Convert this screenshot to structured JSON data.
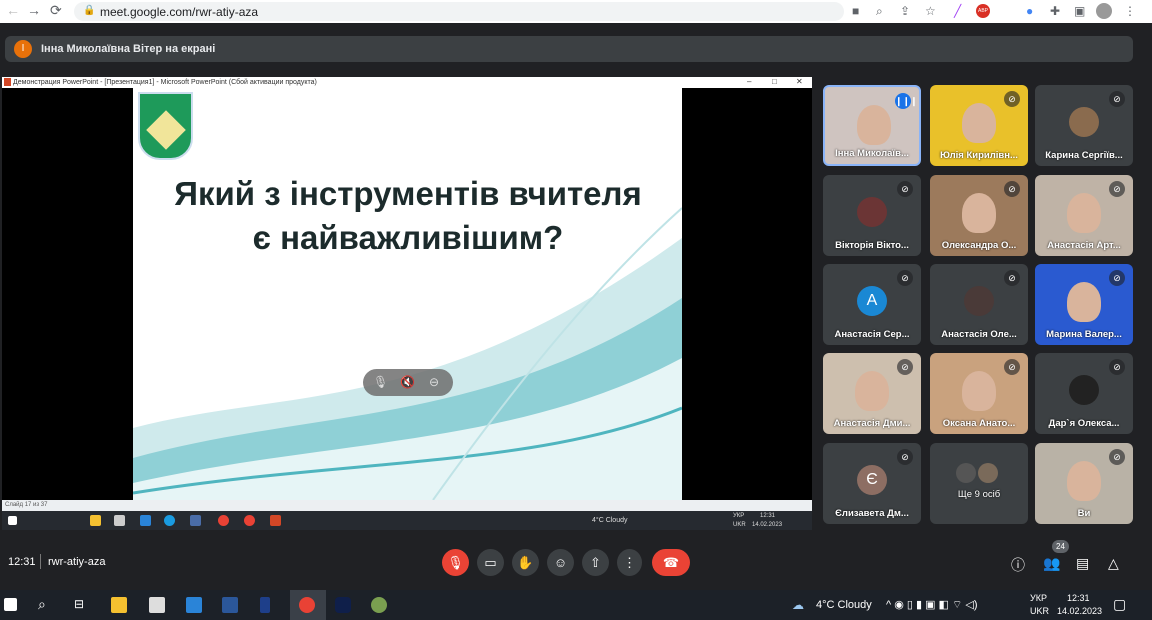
{
  "browser": {
    "url": "meet.google.com/rwr-atiy-aza",
    "back": "←",
    "forward": "→",
    "reload": "⟳",
    "profile_badge": "ABP"
  },
  "banner": {
    "initial": "І",
    "text": "Інна Миколаївна Вітер на екрані"
  },
  "presentation": {
    "window_title": "Демонстрация PowerPoint - [Презентация1] - Microsoft PowerPoint (Сбой активации продукта)",
    "slide_title": "Який з інструментів вчителя є найважливішим?",
    "status": "Слайд 17 из 37",
    "taskbar": {
      "weather": "4°C Cloudy",
      "lang1": "УКР",
      "lang2": "UKR",
      "time": "12:31",
      "date": "14.02.2023"
    }
  },
  "tiles": [
    {
      "name": "Інна Миколаїв...",
      "type": "video",
      "bg": "#cfc4c0",
      "speaking": true
    },
    {
      "name": "Юлія Кирилівн...",
      "type": "video",
      "bg": "#e9c12a"
    },
    {
      "name": "Карина Сергіїв...",
      "type": "photo",
      "bg": "#8a6b4e"
    },
    {
      "name": "Вікторія Вікто...",
      "type": "photo",
      "bg": "#6b3535"
    },
    {
      "name": "Олександра О...",
      "type": "video",
      "bg": "#9c7a5c"
    },
    {
      "name": "Анастасія Арт...",
      "type": "video",
      "bg": "#bfb3a6"
    },
    {
      "name": "Анастасія Сер...",
      "type": "letter",
      "letter": "А",
      "bg": "#1a88d4"
    },
    {
      "name": "Анастасія Оле...",
      "type": "photo",
      "bg": "#4a3a38"
    },
    {
      "name": "Марина Валер...",
      "type": "video",
      "bg": "#2a5ad0"
    },
    {
      "name": "Анастасія Дми...",
      "type": "video",
      "bg": "#cdbfae"
    },
    {
      "name": "Оксана Анато...",
      "type": "video",
      "bg": "#c9a27e"
    },
    {
      "name": "Дар`я Олекса...",
      "type": "photo",
      "bg": "#222"
    },
    {
      "name": "Єлизавета Дм...",
      "type": "letter",
      "letter": "Є",
      "bg": "#8d6e63"
    },
    {
      "name": "Ще 9 осіб",
      "type": "more",
      "bg": "#3c4043"
    },
    {
      "name": "Ви",
      "type": "video",
      "bg": "#b9b2a6"
    }
  ],
  "meeting": {
    "time": "12:31",
    "code": "rwr-atiy-aza",
    "participants_count": "24"
  },
  "windows": {
    "weather": "4°C Cloudy",
    "lang1": "УКР",
    "lang2": "UKR",
    "time": "12:31",
    "date": "14.02.2023"
  }
}
